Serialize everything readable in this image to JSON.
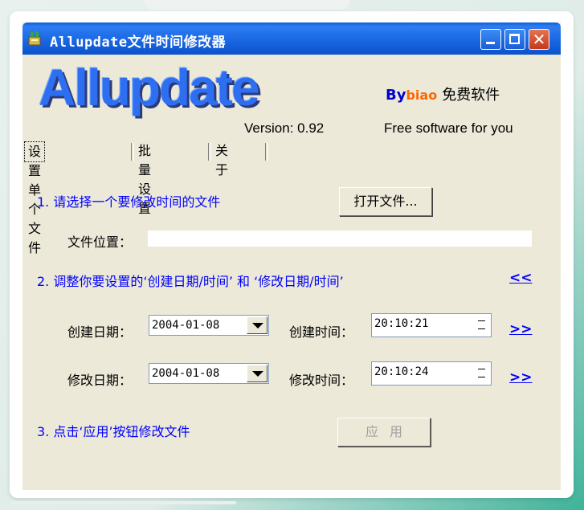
{
  "window": {
    "title": "Allupdate文件时间修改器",
    "close_glyph": "✕"
  },
  "banner": {
    "logo_text": "Allupdate",
    "version": "Version: 0.92",
    "by_prefix": "By",
    "by_name": "biao",
    "free_label": "免费软件",
    "tagline": "Free software for you"
  },
  "tabs": [
    {
      "label": "设置单个文件"
    },
    {
      "label": "批量设置"
    },
    {
      "label": "关 于"
    }
  ],
  "step1": {
    "label": "1. 请选择一个要修改时间的文件",
    "open_button": "打开文件...",
    "file_location_label": "文件位置：",
    "file_location_value": ""
  },
  "step2": {
    "label": "2. 调整你要设置的‘创建日期/时间’ 和 ‘修改日期/时间’",
    "copy_link": "<<",
    "created_date_label": "创建日期：",
    "created_date_value": "2004-01-08",
    "created_time_label": "创建时间：",
    "created_time_value": "20:10:21",
    "created_link": ">>",
    "modified_date_label": "修改日期：",
    "modified_date_value": "2004-01-08",
    "modified_time_label": "修改时间：",
    "modified_time_value": "20:10:24",
    "modified_link": ">>"
  },
  "step3": {
    "label": "3. 点击‘应用’按钮修改文件",
    "apply_button": "应用"
  },
  "colors": {
    "titlebar": "#0b52cc",
    "panel": "#ece9d8",
    "label_blue": "#0000ff",
    "logo_blue": "#2e6ff2",
    "brand_orange": "#ff6600",
    "background_teal": "#3fb39a"
  },
  "icons": {
    "app": "app-icon",
    "minimize": "minimize-icon",
    "maximize": "maximize-icon",
    "close": "close-icon"
  }
}
